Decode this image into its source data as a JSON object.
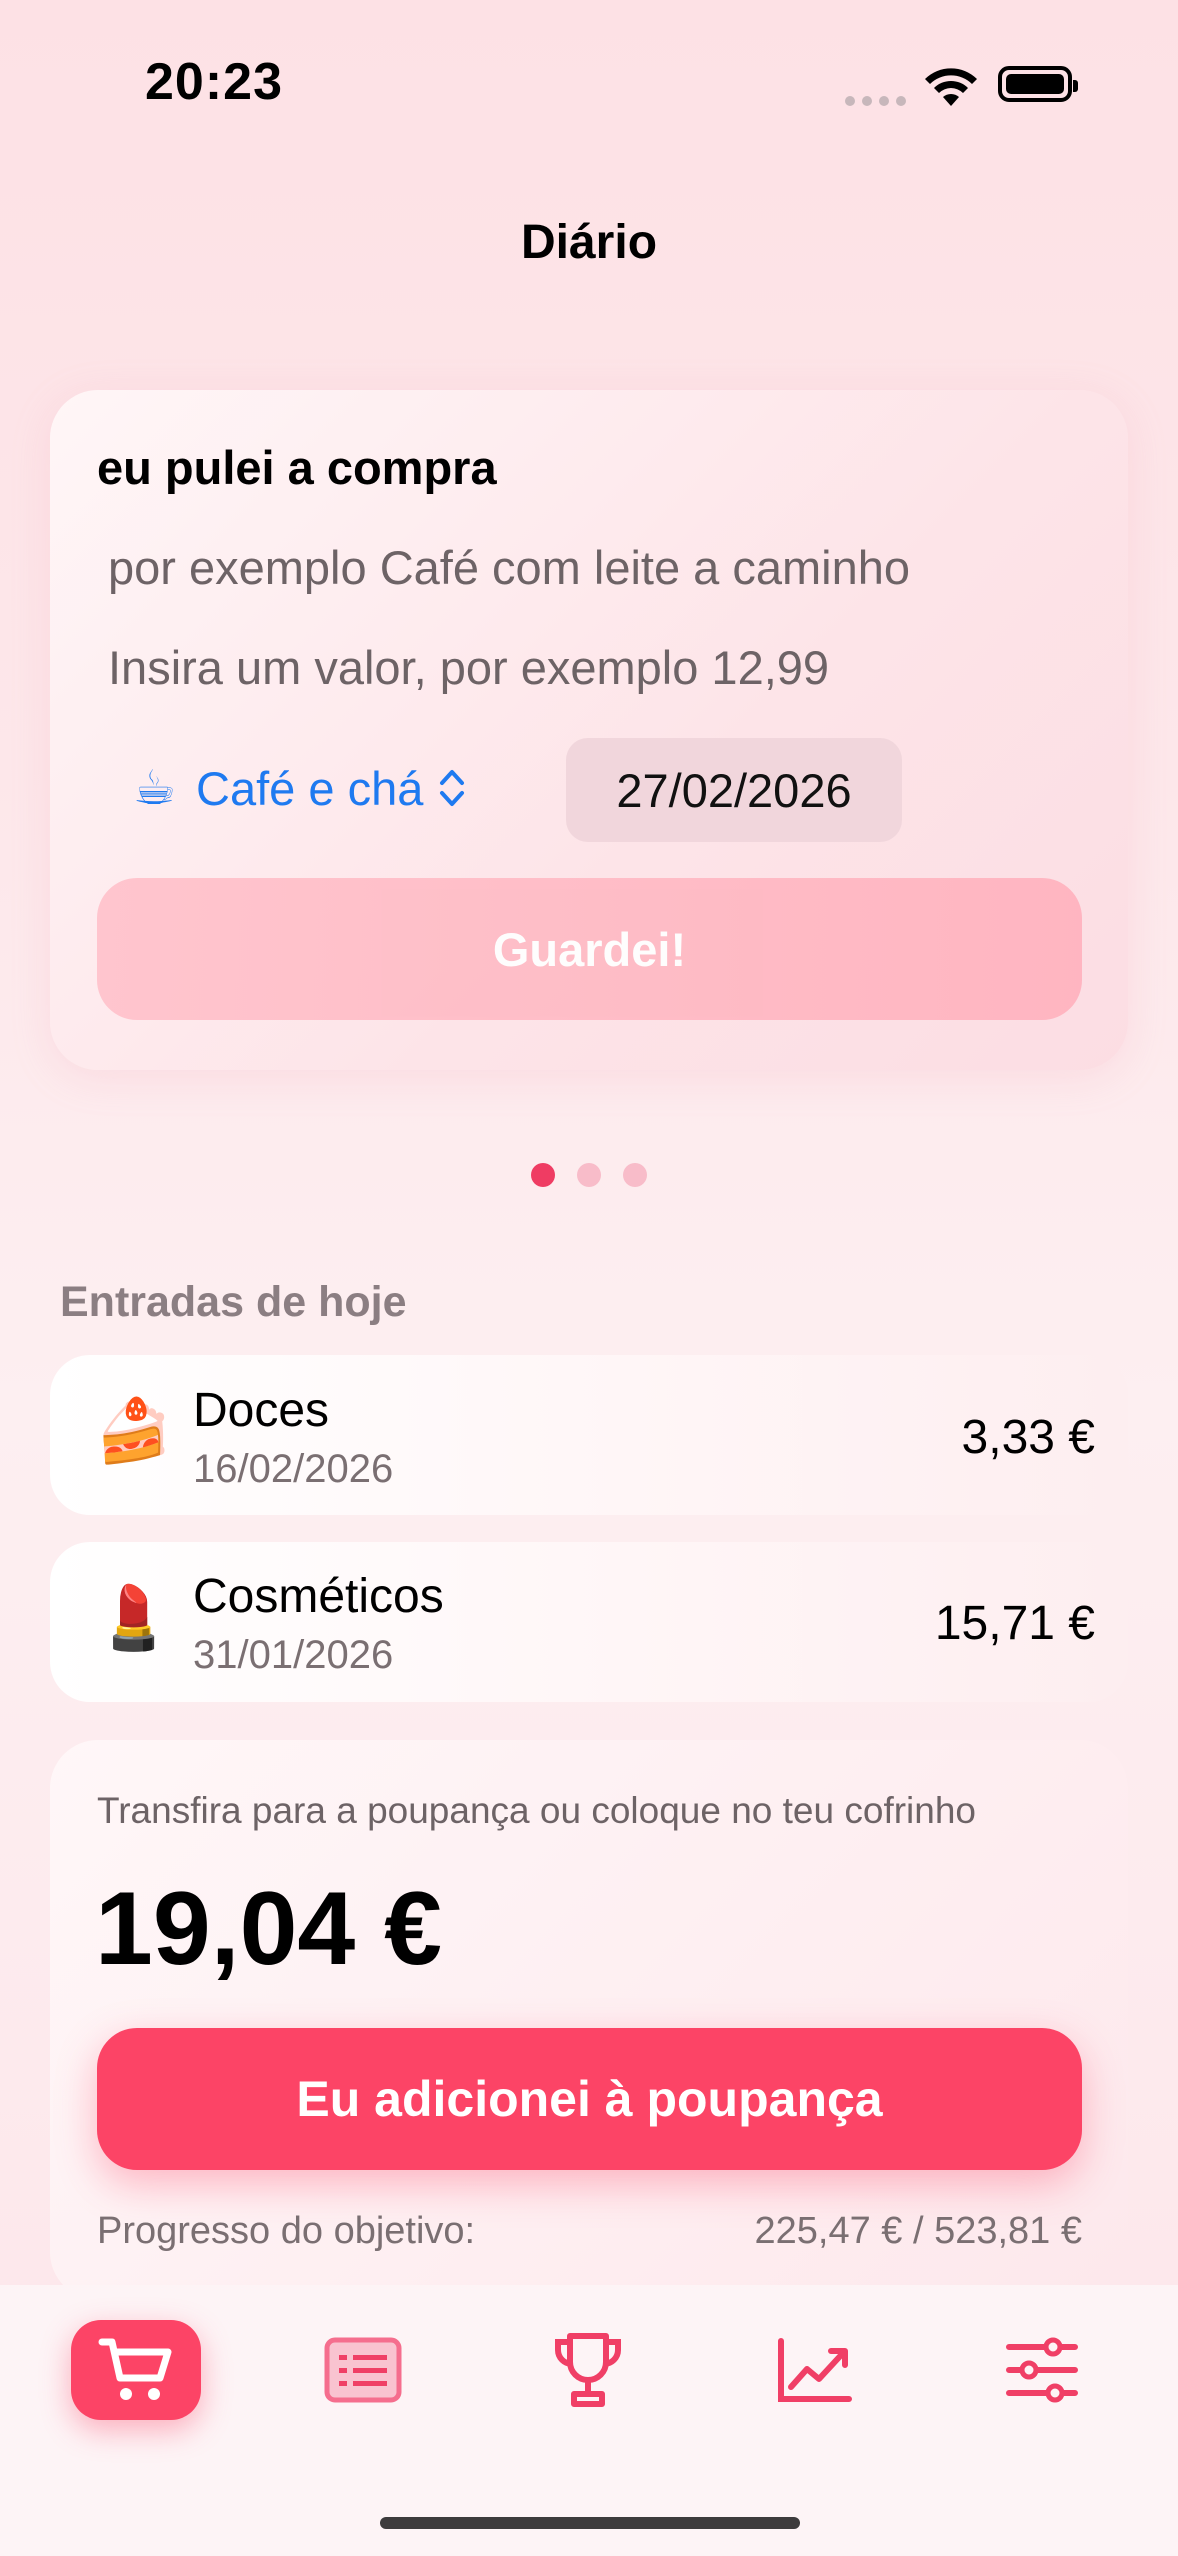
{
  "status_bar": {
    "time": "20:23"
  },
  "header": {
    "title": "Diário"
  },
  "entry_form": {
    "title": "eu pulei a compra",
    "name_placeholder": "por exemplo Café com leite a caminho",
    "amount_placeholder": "Insira um valor, por exemplo 12,99",
    "category_emoji": "☕",
    "category_label": "Café e chá",
    "date": "27/02/2026",
    "save_label": "Guardei!"
  },
  "pager": {
    "pages": 3,
    "current": 1
  },
  "today": {
    "section_label": "Entradas de hoje",
    "entries": [
      {
        "emoji": "🍰",
        "name": "Doces",
        "date": "16/02/2026",
        "amount": "3,33 €"
      },
      {
        "emoji": "💄",
        "name": "Cosméticos",
        "date": "31/01/2026",
        "amount": "15,71 €"
      }
    ]
  },
  "goal": {
    "caption": "Transfira para a poupança ou coloque no teu cofrinho",
    "total": "19,04 €",
    "button_label": "Eu adicionei à poupança",
    "progress_label": "Progresso do objetivo:",
    "progress_value": "225,47 € / 523,81 €"
  },
  "tab_bar": {
    "items": [
      {
        "icon": "cart-icon",
        "active": true
      },
      {
        "icon": "list-icon",
        "active": false
      },
      {
        "icon": "trophy-icon",
        "active": false
      },
      {
        "icon": "chart-icon",
        "active": false
      },
      {
        "icon": "sliders-icon",
        "active": false
      }
    ]
  },
  "colors": {
    "accent": "#fc4466",
    "link": "#1f7af0",
    "page_dot_active": "#ef3c63"
  }
}
